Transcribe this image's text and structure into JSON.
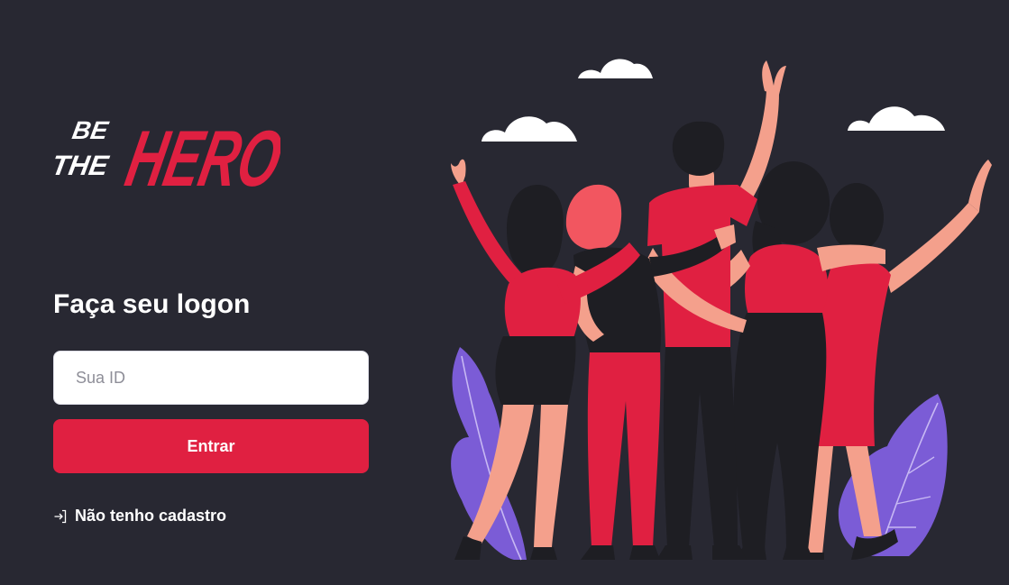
{
  "logo": {
    "line1": "BE",
    "line2": "THE",
    "word": "HERO",
    "brand_color": "#e02041"
  },
  "login": {
    "title": "Faça seu logon",
    "id_placeholder": "Sua ID",
    "id_value": "",
    "submit_label": "Entrar",
    "register_link": "Não tenho cadastro",
    "register_icon": "log-in-icon"
  },
  "theme": {
    "background": "#282832",
    "accent": "#e02041",
    "accent_dark": "#b9142f",
    "skin": "#f4a08c",
    "hair": "#1e1e23",
    "plant": "#7b5cd6"
  }
}
